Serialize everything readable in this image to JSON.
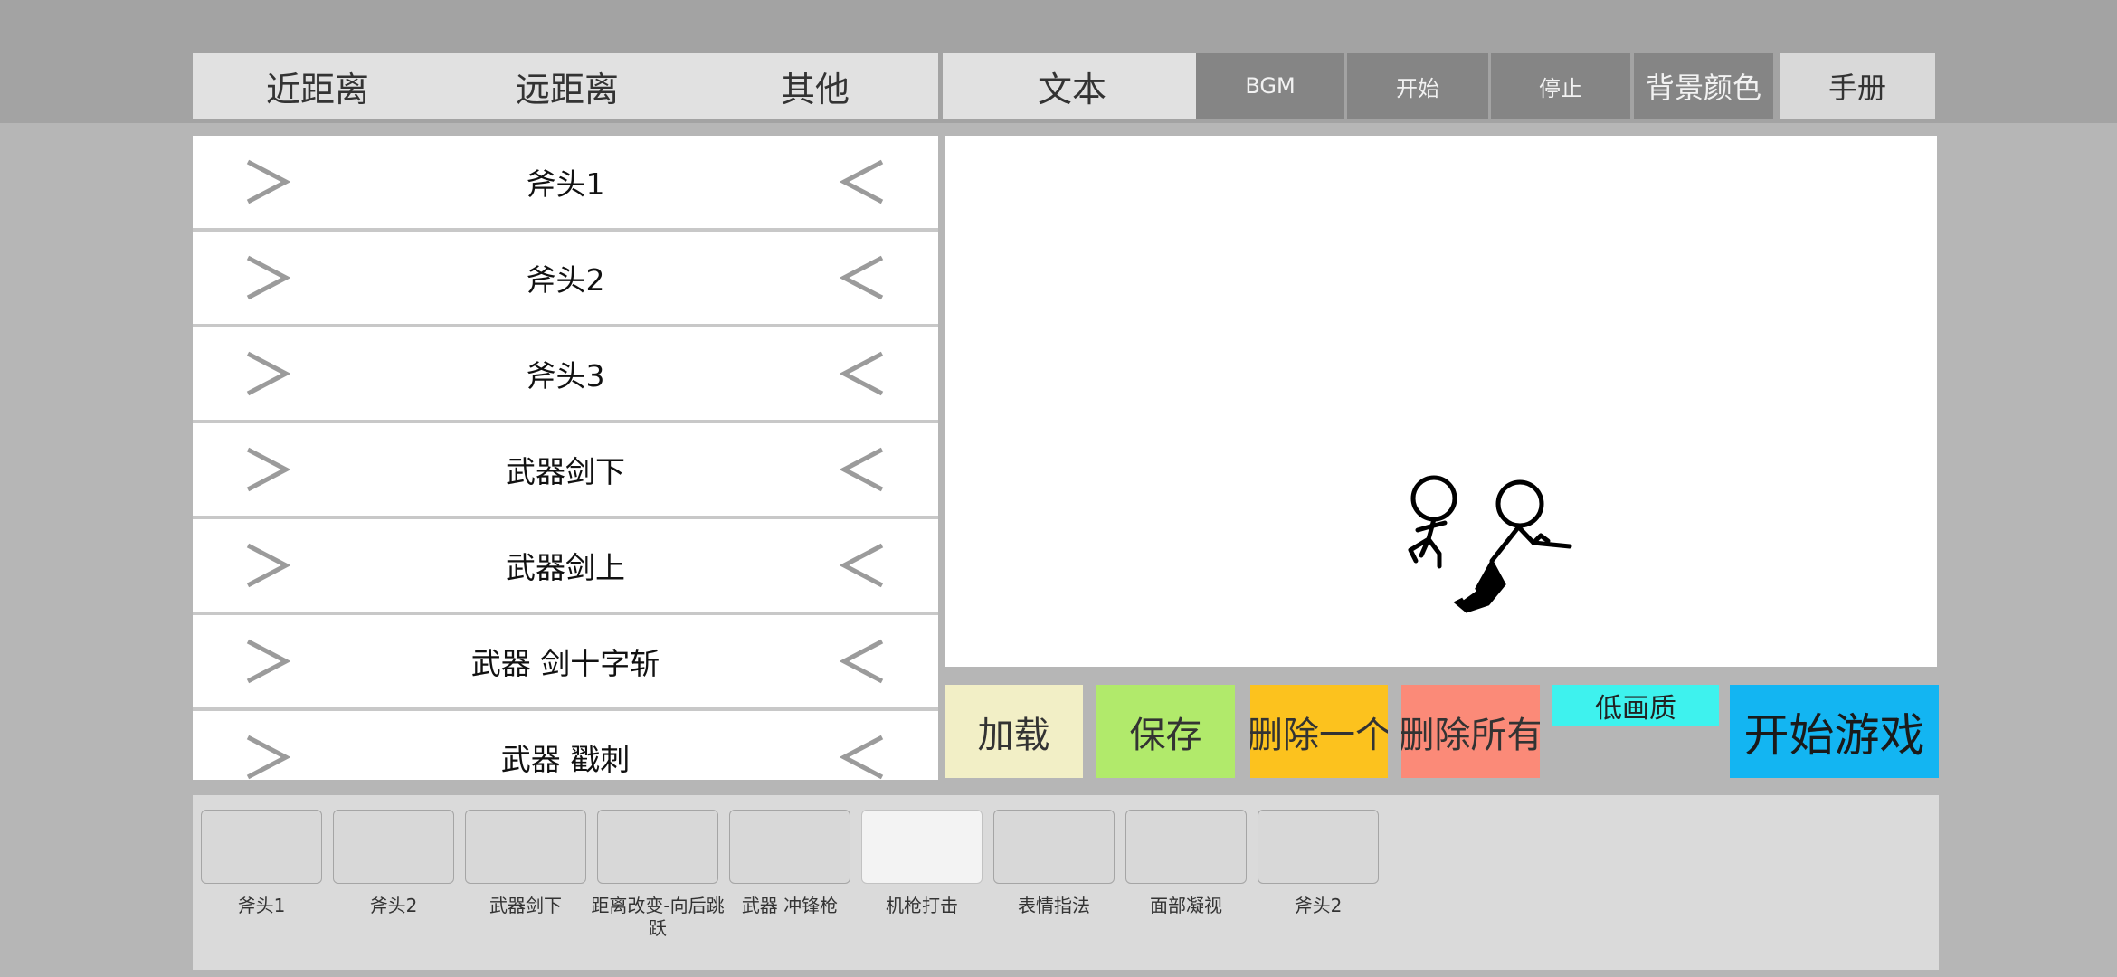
{
  "tabs": {
    "melee": "近距离",
    "ranged": "远距离",
    "other": "其他",
    "text": "文本"
  },
  "controls": {
    "bgm": "BGM",
    "start": "开始",
    "stop": "停止",
    "bg_color": "背景颜色",
    "manual": "手册"
  },
  "list": {
    "items": [
      {
        "label": "斧头1"
      },
      {
        "label": "斧头2"
      },
      {
        "label": "斧头3"
      },
      {
        "label": "武器剑下"
      },
      {
        "label": "武器剑上"
      },
      {
        "label": "武器 剑十字斩"
      },
      {
        "label": "武器 戳刺"
      }
    ],
    "left_icon": "chevron-right-icon",
    "right_icon": "chevron-left-icon"
  },
  "actions": {
    "load": "加载",
    "save": "保存",
    "delete_one": "删除一个",
    "delete_all": "删除所有",
    "low_quality": "低画质",
    "start_game": "开始游戏"
  },
  "colors": {
    "load": "#f2efc6",
    "save": "#b1ea6b",
    "delete_one": "#fcc21e",
    "delete_all": "#fb8a78",
    "low_quality": "#3ef2ee",
    "start_game": "#13b5f2"
  },
  "sequence": {
    "slots": [
      {
        "caption": "斧头1"
      },
      {
        "caption": "斧头2"
      },
      {
        "caption": "武器剑下"
      },
      {
        "caption": "距离改变-向后跳跃"
      },
      {
        "caption": "武器 冲锋枪"
      },
      {
        "caption": "机枪打击",
        "active": true
      },
      {
        "caption": "表情指法"
      },
      {
        "caption": "面部凝视"
      },
      {
        "caption": "斧头2"
      }
    ]
  }
}
